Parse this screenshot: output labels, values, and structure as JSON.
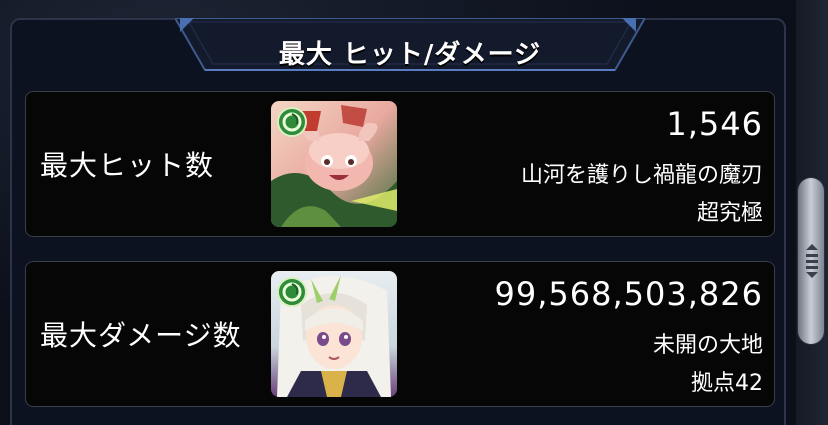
{
  "header": {
    "title": "最大 ヒット/ダメージ"
  },
  "records": [
    {
      "label": "最大ヒット数",
      "value": "1,546",
      "quest_name": "山河を護りし禍龍の魔刃",
      "difficulty": "超究極",
      "avatar_icon": "monster-portrait-pink-creature-icon",
      "element_badge": "wood-element-badge-icon"
    },
    {
      "label": "最大ダメージ数",
      "value": "99,568,503,826",
      "quest_name": "未開の大地",
      "difficulty": "拠点42",
      "avatar_icon": "monster-portrait-white-haired-girl-icon",
      "element_badge": "wood-element-badge-icon"
    }
  ],
  "colors": {
    "panel_bg": "#0d1220",
    "row_bg": "#060606",
    "accent_blue": "#4a6fb0",
    "text": "#ffffff"
  }
}
